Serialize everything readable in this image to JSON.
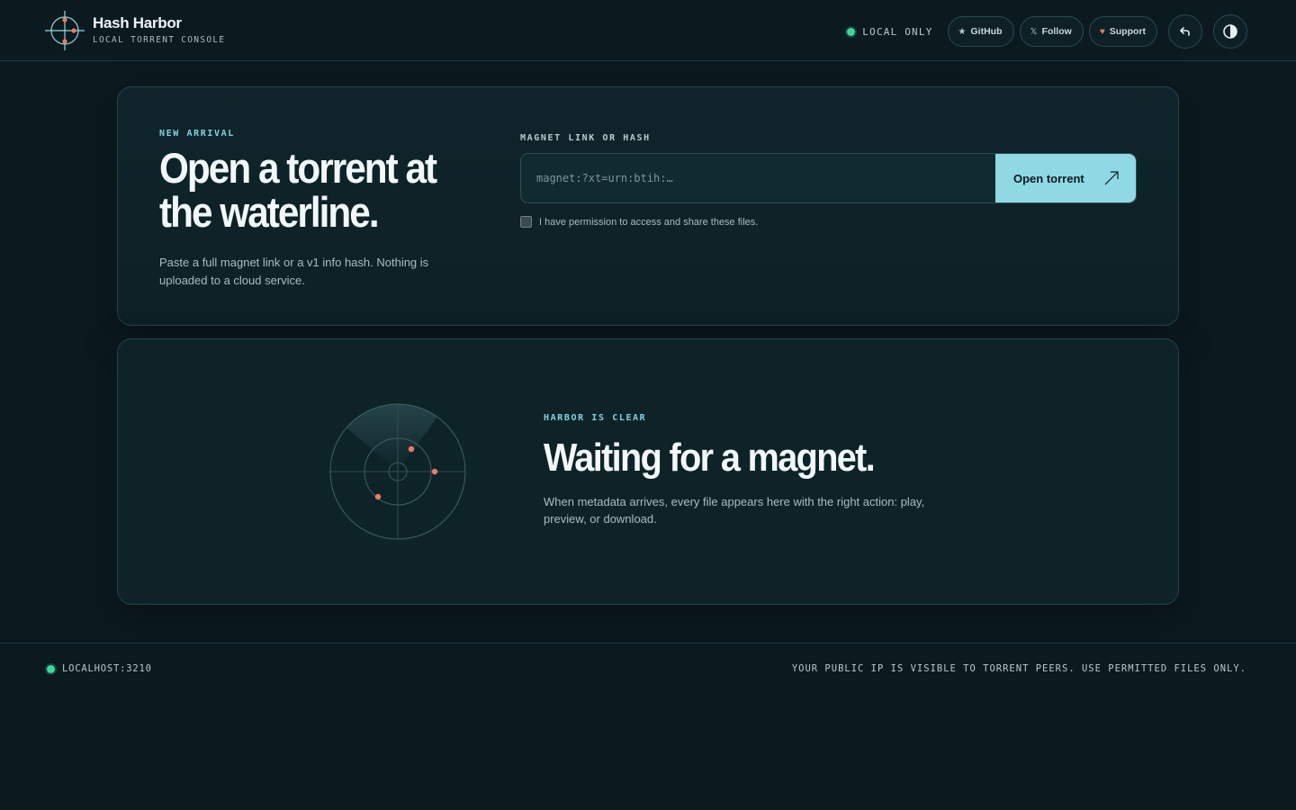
{
  "brand": {
    "title": "Hash Harbor",
    "subtitle": "LOCAL TORRENT CONSOLE",
    "logo_icon": "crosshair-logo-icon"
  },
  "nav": {
    "status_label": "LOCAL ONLY",
    "github_label": "GitHub",
    "follow_label": "Follow",
    "support_label": "Support",
    "undo_icon": "undo-icon",
    "theme_icon": "theme-contrast-icon"
  },
  "open_card": {
    "eyebrow": "NEW ARRIVAL",
    "title": "Open a torrent at the waterline.",
    "description": "Paste a full magnet link or a v1 info hash. Nothing is uploaded to a cloud service.",
    "field_label": "MAGNET LINK OR HASH",
    "input_placeholder": "magnet:?xt=urn:btih:…",
    "input_value": "",
    "button_label": "Open torrent",
    "permission_label": "I have permission to access and share these files.",
    "permission_checked": false
  },
  "wait_card": {
    "eyebrow": "HARBOR IS CLEAR",
    "title": "Waiting for a magnet.",
    "description": "When metadata arrives, every file appears here with the right action: play, preview, or download."
  },
  "footer": {
    "host": "LOCALHOST:3210",
    "notice": "YOUR PUBLIC IP IS VISIBLE TO TORRENT PEERS. USE PERMITTED FILES ONLY."
  },
  "colors": {
    "background": "#0b1a1f",
    "accent": "#8fd8e4",
    "status_green": "#3fd69a",
    "marker_orange": "#f07a5f"
  }
}
